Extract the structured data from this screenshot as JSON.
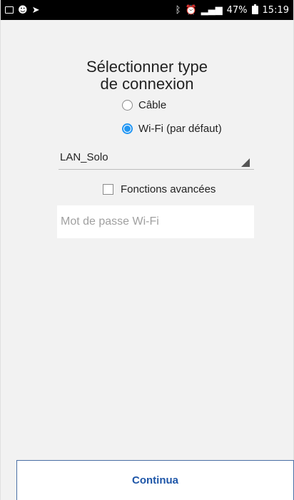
{
  "status_bar": {
    "left_icons": [
      "image-icon",
      "notification-face-icon",
      "send-icon"
    ],
    "right_icons": [
      "bluetooth-icon",
      "alarm-icon",
      "signal-icon"
    ],
    "battery": "47%",
    "time": "15:19"
  },
  "title_line1": "Sélectionner type",
  "title_line2": "de connexion",
  "options": {
    "cable": {
      "label": "Câble",
      "selected": false
    },
    "wifi": {
      "label": "Wi-Fi (par défaut)",
      "selected": true
    }
  },
  "network_select": {
    "value": "LAN_Solo"
  },
  "advanced": {
    "label": "Fonctions avancées",
    "checked": false
  },
  "password": {
    "placeholder": "Mot de passe Wi-Fi"
  },
  "footer": {
    "button_label": "Continua"
  },
  "colors": {
    "accent": "#2196f3",
    "button_text": "#1e56a8",
    "background": "#f2f2f2"
  }
}
